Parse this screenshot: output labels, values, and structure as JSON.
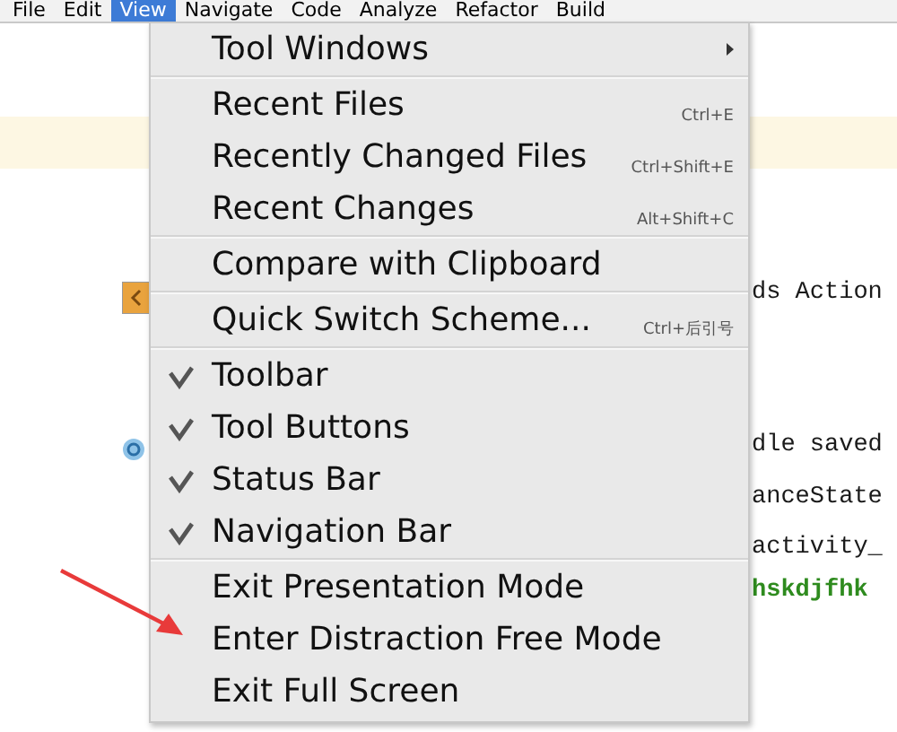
{
  "menu_bar": [
    {
      "label": "File",
      "selected": false
    },
    {
      "label": "Edit",
      "selected": false
    },
    {
      "label": "View",
      "selected": true
    },
    {
      "label": "Navigate",
      "selected": false
    },
    {
      "label": "Code",
      "selected": false
    },
    {
      "label": "Analyze",
      "selected": false
    },
    {
      "label": "Refactor",
      "selected": false
    },
    {
      "label": "Build",
      "selected": false
    }
  ],
  "editor": {
    "code_lines": [
      {
        "text": "ds Action",
        "kind": "code"
      },
      {
        "text": "dle saved",
        "kind": "code"
      },
      {
        "text": "anceState",
        "kind": "code"
      },
      {
        "text": "activity_",
        "kind": "code"
      },
      {
        "text": "hskdjfhk",
        "kind": "string"
      }
    ]
  },
  "view_menu": {
    "groups": [
      [
        {
          "label": "Tool Windows",
          "submenu": true
        }
      ],
      [
        {
          "label": "Recent Files",
          "shortcut": "Ctrl+E"
        },
        {
          "label": "Recently Changed Files",
          "shortcut": "Ctrl+Shift+E"
        },
        {
          "label": "Recent Changes",
          "shortcut": "Alt+Shift+C"
        }
      ],
      [
        {
          "label": "Compare with Clipboard"
        }
      ],
      [
        {
          "label": "Quick Switch Scheme...",
          "shortcut": "Ctrl+后引号"
        }
      ],
      [
        {
          "label": "Toolbar",
          "checked": true
        },
        {
          "label": "Tool Buttons",
          "checked": true
        },
        {
          "label": "Status Bar",
          "checked": true
        },
        {
          "label": "Navigation Bar",
          "checked": true
        }
      ],
      [
        {
          "label": "Exit Presentation Mode"
        },
        {
          "label": "Enter Distraction Free Mode"
        },
        {
          "label": "Exit Full Screen"
        }
      ]
    ]
  }
}
